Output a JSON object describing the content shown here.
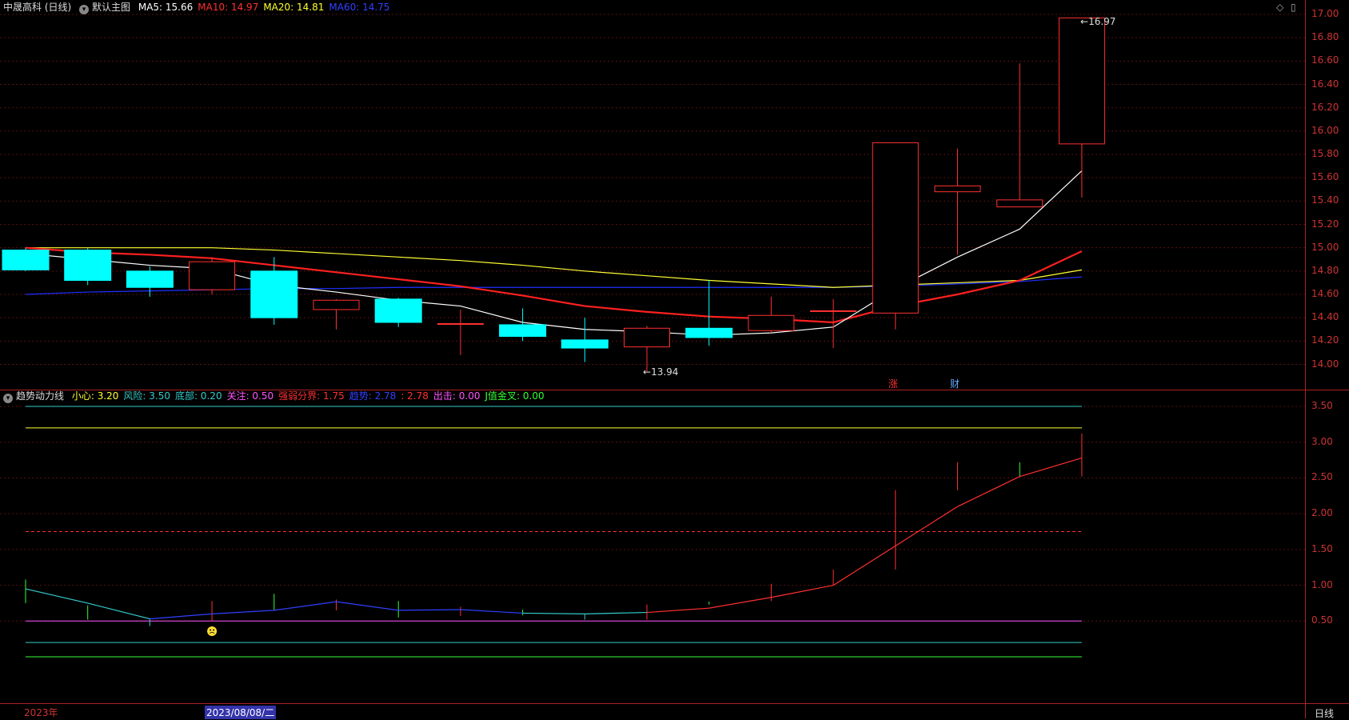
{
  "header_main": {
    "stock": "中晟高科 (日线)",
    "indicator_menu": "默认主图",
    "ma": [
      {
        "label": "MA5: 15.66",
        "color": "#ffffff"
      },
      {
        "label": "MA10: 14.97",
        "color": "#ff3030"
      },
      {
        "label": "MA20: 14.81",
        "color": "#ffff33"
      },
      {
        "label": "MA60: 14.75",
        "color": "#3040ff"
      }
    ]
  },
  "header_sub": {
    "name": "趋势动力线",
    "items": [
      {
        "label": "小心: 3.20",
        "color": "#ffff33"
      },
      {
        "label": "风险: 3.50",
        "color": "#33cccc"
      },
      {
        "label": "底部: 0.20",
        "color": "#33cccc"
      },
      {
        "label": "关注: 0.50",
        "color": "#ff55ff"
      },
      {
        "label": "强弱分界: 1.75",
        "color": "#ff3030"
      },
      {
        "label": "趋势: 2.78",
        "color": "#3040ff"
      },
      {
        "label": ": 2.78",
        "color": "#ff3030"
      },
      {
        "label": "出击: 0.00",
        "color": "#ff55ff"
      },
      {
        "label": "J值金叉: 0.00",
        "color": "#33ff33"
      }
    ]
  },
  "window_controls": {
    "diamond": "◇",
    "restore": "▯"
  },
  "icons": {
    "diamond": "diamond-icon",
    "restore": "restore-icon",
    "menu": "chevron-circle-icon",
    "smiley": "smiley-icon"
  },
  "colors": {
    "up": "#ff3030",
    "down": "#00ffff",
    "ma5": "#ffffff",
    "ma10": "#ff2020",
    "ma20": "#ffff33",
    "ma60": "#2030ff",
    "axis": "#cc3333",
    "grid": "#5a1010"
  },
  "main_axis": {
    "labels": [
      "17.00",
      "16.80",
      "16.60",
      "16.40",
      "16.20",
      "16.00",
      "15.80",
      "15.60",
      "15.40",
      "15.20",
      "15.00",
      "14.80",
      "14.60",
      "14.40",
      "14.20",
      "14.00"
    ]
  },
  "sub_axis": {
    "labels": [
      "3.50",
      "3.00",
      "2.50",
      "2.00",
      "1.50",
      "1.00",
      "0.50"
    ]
  },
  "annotations": {
    "high": "16.97",
    "low": "13.94",
    "zhang": "涨",
    "cai": "财"
  },
  "bottom": {
    "year": "2023年",
    "date": "2023/08/08/二",
    "period": "日线"
  },
  "chart_data": {
    "type": "candlestick",
    "main_ylim": [
      13.8,
      17.05
    ],
    "sub_ylim": [
      0.0,
      3.75
    ],
    "candles": [
      {
        "o": 14.98,
        "h": 15.0,
        "l": 14.8,
        "c": 14.81
      },
      {
        "o": 14.98,
        "h": 15.0,
        "l": 14.68,
        "c": 14.72
      },
      {
        "o": 14.8,
        "h": 14.84,
        "l": 14.58,
        "c": 14.66
      },
      {
        "o": 14.64,
        "h": 14.92,
        "l": 14.6,
        "c": 14.88
      },
      {
        "o": 14.8,
        "h": 14.92,
        "l": 14.34,
        "c": 14.4
      },
      {
        "o": 14.47,
        "h": 14.56,
        "l": 14.3,
        "c": 14.55
      },
      {
        "o": 14.56,
        "h": 14.57,
        "l": 14.32,
        "c": 14.36
      },
      {
        "o": 14.35,
        "h": 14.47,
        "l": 14.08,
        "c": 14.35
      },
      {
        "o": 14.34,
        "h": 14.48,
        "l": 14.2,
        "c": 14.24
      },
      {
        "o": 14.21,
        "h": 14.4,
        "l": 14.02,
        "c": 14.14
      },
      {
        "o": 14.15,
        "h": 14.33,
        "l": 13.94,
        "c": 14.31
      },
      {
        "o": 14.31,
        "h": 14.72,
        "l": 14.16,
        "c": 14.23
      },
      {
        "o": 14.29,
        "h": 14.58,
        "l": 14.27,
        "c": 14.42
      },
      {
        "o": 14.46,
        "h": 14.56,
        "l": 14.14,
        "c": 14.46
      },
      {
        "o": 14.44,
        "h": 15.9,
        "l": 14.3,
        "c": 15.9
      },
      {
        "o": 15.48,
        "h": 15.85,
        "l": 14.94,
        "c": 15.53
      },
      {
        "o": 15.35,
        "h": 16.58,
        "l": 15.35,
        "c": 15.41
      },
      {
        "o": 15.89,
        "h": 16.97,
        "l": 15.43,
        "c": 16.97
      }
    ],
    "ma5": [
      14.95,
      14.9,
      14.85,
      14.82,
      14.68,
      14.62,
      14.55,
      14.5,
      14.36,
      14.3,
      14.28,
      14.25,
      14.27,
      14.32,
      14.65,
      14.92,
      15.16,
      15.66
    ],
    "ma10": [
      15.0,
      14.96,
      14.94,
      14.91,
      14.85,
      14.79,
      14.73,
      14.67,
      14.59,
      14.5,
      14.45,
      14.41,
      14.39,
      14.36,
      14.5,
      14.6,
      14.72,
      14.97
    ],
    "ma20": [
      15.0,
      15.0,
      15.0,
      15.0,
      14.98,
      14.95,
      14.92,
      14.89,
      14.85,
      14.8,
      14.76,
      14.72,
      14.69,
      14.66,
      14.68,
      14.7,
      14.72,
      14.81
    ],
    "ma60": [
      14.6,
      14.62,
      14.63,
      14.64,
      14.65,
      14.65,
      14.66,
      14.66,
      14.66,
      14.66,
      14.66,
      14.66,
      14.66,
      14.66,
      14.67,
      14.69,
      14.71,
      14.75
    ],
    "sub": {
      "trend": [
        0.95,
        0.75,
        0.53,
        0.6,
        0.65,
        0.77,
        0.65,
        0.66,
        0.61,
        0.6,
        0.62,
        0.68,
        0.83,
        1.0,
        1.55,
        2.1,
        2.52,
        2.78
      ],
      "bars": [
        {
          "a": 0.75,
          "b": 1.08,
          "color": "#33ff33"
        },
        {
          "a": 0.52,
          "b": 0.72,
          "color": "#33ff33"
        },
        {
          "a": 0.43,
          "b": 0.53,
          "color": "#33cccc"
        },
        {
          "a": 0.5,
          "b": 0.78,
          "color": "#ff3030"
        },
        {
          "a": 0.65,
          "b": 0.88,
          "color": "#33ff33"
        },
        {
          "a": 0.65,
          "b": 0.8,
          "color": "#ff3030"
        },
        {
          "a": 0.55,
          "b": 0.78,
          "color": "#33ff33"
        },
        {
          "a": 0.57,
          "b": 0.7,
          "color": "#ff3030"
        },
        {
          "a": 0.58,
          "b": 0.66,
          "color": "#33ff33"
        },
        {
          "a": 0.52,
          "b": 0.6,
          "color": "#33cccc"
        },
        {
          "a": 0.52,
          "b": 0.73,
          "color": "#ff3030"
        },
        {
          "a": 0.73,
          "b": 0.77,
          "color": "#33ff33"
        },
        {
          "a": 0.78,
          "b": 1.02,
          "color": "#ff3030"
        },
        {
          "a": 1.0,
          "b": 1.22,
          "color": "#ff3030"
        },
        {
          "a": 1.22,
          "b": 2.33,
          "color": "#ff3030"
        },
        {
          "a": 2.33,
          "b": 2.72,
          "color": "#ff3030"
        },
        {
          "a": 2.52,
          "b": 2.72,
          "color": "#33ff33"
        },
        {
          "a": 2.52,
          "b": 3.12,
          "color": "#ff3030"
        }
      ],
      "levels": [
        {
          "v": 3.5,
          "color": "#33cccc",
          "dash": false
        },
        {
          "v": 3.2,
          "color": "#ffff33",
          "dash": false
        },
        {
          "v": 1.75,
          "color": "#ff3030",
          "dash": true
        },
        {
          "v": 0.5,
          "color": "#ff55ff",
          "dash": false
        },
        {
          "v": 0.2,
          "color": "#33cccc",
          "dash": false
        },
        {
          "v": 0.0,
          "color": "#33ff33",
          "dash": false
        }
      ]
    }
  }
}
